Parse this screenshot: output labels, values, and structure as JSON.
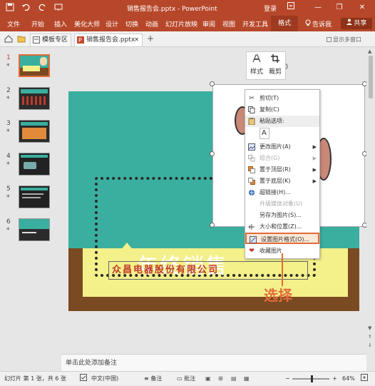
{
  "window": {
    "title": "销售报告会.pptx - PowerPoint",
    "login": "登录",
    "min_glyph": "—",
    "max_glyph": "❐",
    "close_glyph": "✕"
  },
  "quick_access": {
    "save_icon": "save-icon",
    "undo_icon": "undo-icon",
    "redo_icon": "redo-icon",
    "present_icon": "present-icon"
  },
  "ribbon": {
    "tabs": [
      "文件",
      "开始",
      "插入",
      "美化大师",
      "设计",
      "切换",
      "动画",
      "幻灯片放映",
      "审阅",
      "视图",
      "开发工具"
    ],
    "format_tab": "格式",
    "tell_me": "告诉我",
    "share": "共享"
  },
  "doc_tabs": {
    "template_tab": "模板专区",
    "file_tab": "销售报告会.pptx",
    "add_tab": "+",
    "multi_window": "显示多窗口"
  },
  "thumbnails": [
    {
      "num": "1",
      "star": "*"
    },
    {
      "num": "2",
      "star": "*"
    },
    {
      "num": "3",
      "star": "*"
    },
    {
      "num": "4",
      "star": "*"
    },
    {
      "num": "5",
      "star": "*"
    },
    {
      "num": "6",
      "star": "*"
    }
  ],
  "slide": {
    "title": "年终销售",
    "company": "众昌电器股份有限公司"
  },
  "mini_toolbar": {
    "style_label": "样式",
    "crop_label": "裁剪"
  },
  "context_menu": {
    "cut": "剪切(T)",
    "copy": "复制(C)",
    "paste_options": "粘贴选项:",
    "change_picture": "更改图片(A)",
    "group": "组合(G)",
    "bring_front": "置于顶层(R)",
    "send_back": "置于底层(K)",
    "hyperlink": "超链接(H)...",
    "upgrade_media": "升级媒体对象(U)",
    "save_as_picture": "另存为图片(S)...",
    "size_position": "大小和位置(Z)...",
    "format_picture": "设置图片格式(O)...",
    "favorite_picture": "收藏图片"
  },
  "callout": "选择",
  "notes_placeholder": "单击此处添加备注",
  "status": {
    "slide_info": "幻灯片 第 1 张，共 6 张",
    "language": "中文(中国)",
    "notes": "备注",
    "comments": "批注",
    "zoom": "64%",
    "zoom_minus": "−",
    "zoom_plus": "+"
  },
  "colors": {
    "accent": "#b7472a",
    "highlight": "#e06b3a",
    "teal": "#3aaf9f",
    "note_yellow": "#f4f08a",
    "company_red": "#c0392b"
  }
}
